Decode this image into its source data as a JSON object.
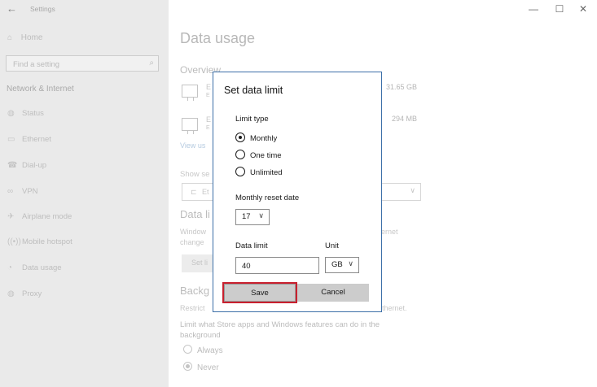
{
  "window": {
    "title": "Settings",
    "controls": {
      "minimize": "—",
      "maximize": "☐",
      "close": "✕"
    }
  },
  "sidebar": {
    "home_label": "Home",
    "search_placeholder": "Find a setting",
    "section_title": "Network & Internet",
    "items": [
      {
        "label": "Status",
        "icon": "globe-icon"
      },
      {
        "label": "Ethernet",
        "icon": "ethernet-icon"
      },
      {
        "label": "Dial-up",
        "icon": "dialup-icon"
      },
      {
        "label": "VPN",
        "icon": "vpn-icon"
      },
      {
        "label": "Airplane mode",
        "icon": "airplane-icon"
      },
      {
        "label": "Mobile hotspot",
        "icon": "hotspot-icon"
      },
      {
        "label": "Data usage",
        "icon": "data-usage-icon"
      },
      {
        "label": "Proxy",
        "icon": "globe-icon"
      }
    ]
  },
  "main": {
    "page_title": "Data usage",
    "overview_title": "Overview",
    "connections": [
      {
        "label": "E",
        "sub": "E",
        "usage": "31.65 GB"
      },
      {
        "label": "E",
        "sub": "E",
        "usage": "294 MB"
      }
    ],
    "view_link": "View us",
    "show_settings_label": "Show se",
    "select_value": "Et",
    "data_limit_title": "Data li",
    "data_limit_desc_1": "Window",
    "data_limit_desc_1_tail": "hernet",
    "data_limit_desc_2": "change",
    "set_limit_button": "Set li",
    "background_title": "Backg",
    "background_desc_lead": "Restrict",
    "background_desc_tail": "thernet.",
    "limit_text": "Limit what Store apps and Windows features can do in the background",
    "always_label": "Always",
    "never_label": "Never"
  },
  "dialog": {
    "title": "Set data limit",
    "limit_type_label": "Limit type",
    "options": [
      "Monthly",
      "One time",
      "Unlimited"
    ],
    "selected_option": "Monthly",
    "reset_date_label": "Monthly reset date",
    "reset_date_value": "17",
    "data_limit_label": "Data limit",
    "data_limit_value": "40",
    "unit_label": "Unit",
    "unit_value": "GB",
    "save_label": "Save",
    "cancel_label": "Cancel"
  },
  "colors": {
    "dialog_border": "#3c6fa8",
    "highlight": "#c8202e",
    "button_bg": "#cccccc"
  }
}
